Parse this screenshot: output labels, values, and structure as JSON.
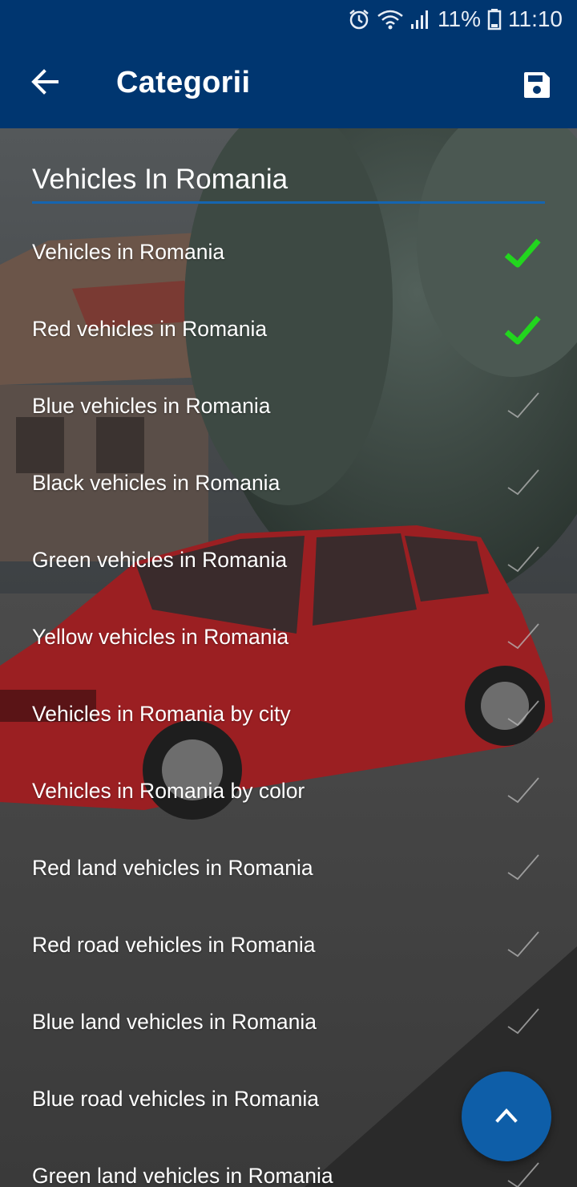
{
  "status_bar": {
    "battery_percent": "11%",
    "time": "11:10",
    "icons": [
      "alarm-icon",
      "wifi-icon",
      "signal-icon",
      "battery-icon"
    ]
  },
  "app_bar": {
    "title": "Categorii",
    "back_icon": "arrow-left-icon",
    "save_icon": "floppy-disk-icon"
  },
  "search": {
    "value": "Vehicles In Romania"
  },
  "categories": [
    {
      "label": "Vehicles in Romania",
      "checked": true
    },
    {
      "label": "Red vehicles in Romania",
      "checked": true
    },
    {
      "label": "Blue vehicles in Romania",
      "checked": false
    },
    {
      "label": "Black vehicles in Romania",
      "checked": false
    },
    {
      "label": "Green vehicles in Romania",
      "checked": false
    },
    {
      "label": "Yellow vehicles in Romania",
      "checked": false
    },
    {
      "label": "Vehicles in Romania by city",
      "checked": false
    },
    {
      "label": "Vehicles in Romania by color",
      "checked": false
    },
    {
      "label": "Red land vehicles in Romania",
      "checked": false
    },
    {
      "label": "Red road vehicles in Romania",
      "checked": false
    },
    {
      "label": "Blue land vehicles in Romania",
      "checked": false
    },
    {
      "label": "Blue road vehicles in Romania",
      "checked": false
    },
    {
      "label": "Green land vehicles in Romania",
      "checked": false
    }
  ],
  "fab": {
    "icon": "chevron-up-icon"
  },
  "colors": {
    "primary": "#003670",
    "accent_underline": "#1565b0",
    "fab": "#0e5ea8",
    "check_active": "#22d61e",
    "check_inactive": "#b9b9b9"
  }
}
